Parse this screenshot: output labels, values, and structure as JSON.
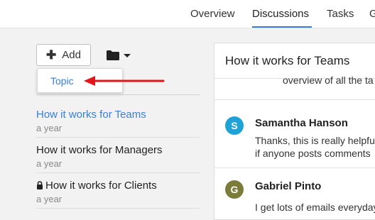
{
  "header": {
    "tabs": [
      {
        "label": "Overview",
        "active": false
      },
      {
        "label": "Discussions",
        "active": true
      },
      {
        "label": "Tasks",
        "active": false
      },
      {
        "label": "G",
        "active": false
      }
    ]
  },
  "toolbar": {
    "add_label": "Add",
    "add_icon": "plus-icon",
    "folder_icon": "folder-icon"
  },
  "dropdown": {
    "items": [
      {
        "label": "Topic"
      }
    ]
  },
  "topics": [
    {
      "title": "How it works for Teams",
      "time": "a year",
      "active": true,
      "locked": false
    },
    {
      "title": "How it works for Managers",
      "time": "a year",
      "active": false,
      "locked": false
    },
    {
      "title": "How it works for Clients",
      "time": "a year",
      "active": false,
      "locked": true
    }
  ],
  "discussion": {
    "title": "How it works for Teams",
    "overflow_text": "overview of all the ta",
    "comments": [
      {
        "initial": "S",
        "author": "Samantha Hanson",
        "avatar_color": "#1fa3d6",
        "lines": [
          "Thanks, this is really helpfu",
          "if anyone posts comments"
        ]
      },
      {
        "initial": "G",
        "author": "Gabriel Pinto",
        "avatar_color": "#7b7b3a",
        "lines": [
          "I get lots of emails everyday"
        ]
      }
    ]
  },
  "colors": {
    "accent": "#3a7fd5",
    "annotation_arrow": "#e0161b"
  }
}
